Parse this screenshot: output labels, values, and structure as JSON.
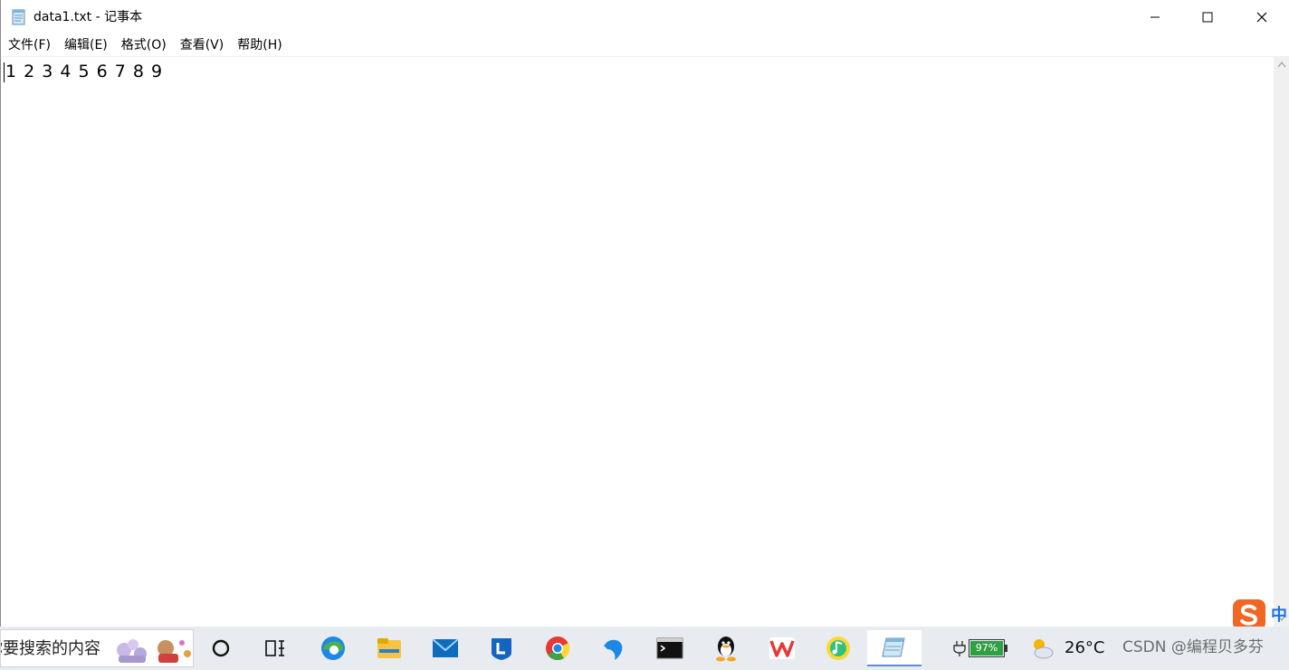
{
  "window": {
    "title": "data1.txt - 记事本"
  },
  "menu": {
    "items": [
      {
        "label": "文件(F)"
      },
      {
        "label": "编辑(E)"
      },
      {
        "label": "格式(O)"
      },
      {
        "label": "查看(V)"
      },
      {
        "label": "帮助(H)"
      }
    ]
  },
  "editor": {
    "content": "1 2 3 4 5 6 7 8 9"
  },
  "taskbar": {
    "search_text": "在这里输入你要搜索的内容",
    "battery_percent": "97%",
    "temperature": "26°C",
    "watermark": "CSDN @编程贝多芬",
    "ime_language": "中",
    "icons": [
      "cortana-icon",
      "task-view-icon",
      "edge-icon",
      "file-explorer-icon",
      "mail-icon",
      "lenovo-icon",
      "chrome-icon",
      "dolphin-icon",
      "terminal-icon",
      "qq-icon",
      "wps-icon",
      "qq-music-icon",
      "notepad-icon"
    ]
  },
  "colors": {
    "battery": "#2ea043",
    "taskbar_bg": "#e8ecf0",
    "active_indicator": "#5a8fd8",
    "sogou_orange": "#f26522",
    "ime_blue": "#1a73e8"
  }
}
